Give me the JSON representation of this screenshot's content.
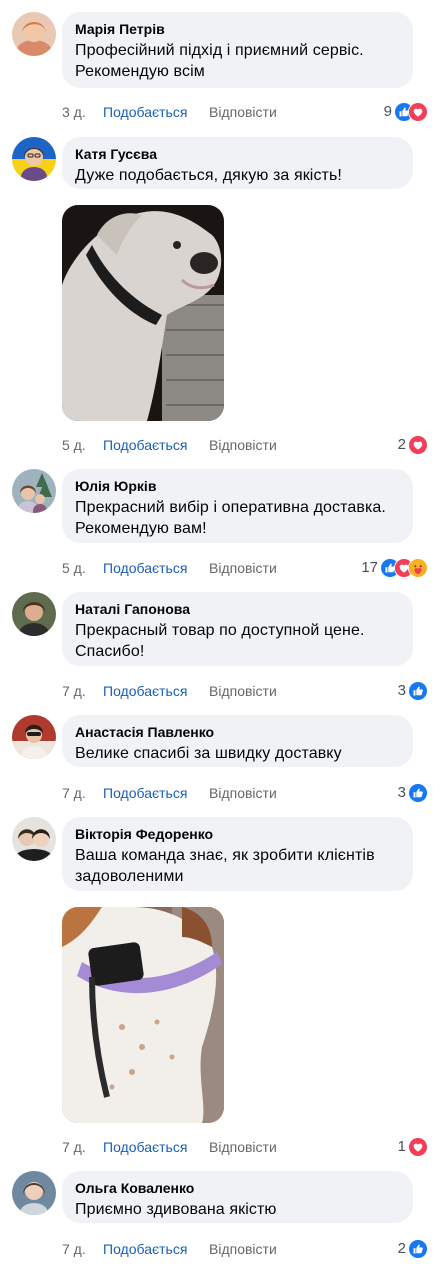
{
  "actions": {
    "like": "Подобається",
    "reply": "Відповісти"
  },
  "comments": [
    {
      "author": "Марія Петрів",
      "text": "Професійний підхід і приємний сервіс. Рекомендую всім",
      "time": "3 д.",
      "reactions_count": "9",
      "reactions": [
        "like-icon",
        "love-icon"
      ]
    },
    {
      "author": "Катя Гусєва",
      "text": "Дуже подобається, дякую за якість!",
      "time": "5 д.",
      "reactions_count": "2",
      "reactions": [
        "love-icon"
      ],
      "has_photo": true
    },
    {
      "author": "Юлія Юрків",
      "text": "Прекрасний вибір і оперативна доставка. Рекомендую вам!",
      "time": "5 д.",
      "reactions_count": "17",
      "reactions": [
        "like-icon",
        "love-icon",
        "care-icon"
      ]
    },
    {
      "author": "Наталі Гапонова",
      "text": "Прекрасный товар по доступной цене. Спасибо!",
      "time": "7 д.",
      "reactions_count": "3",
      "reactions": [
        "like-icon"
      ]
    },
    {
      "author": "Анастасія Павленко",
      "text": "Велике спасибі за швидку доставку",
      "time": "7 д.",
      "reactions_count": "3",
      "reactions": [
        "like-icon"
      ]
    },
    {
      "author": "Вікторія Федоренко",
      "text": "Ваша команда знає, як зробити клієнтів задоволеними",
      "time": "7 д.",
      "reactions_count": "1",
      "reactions": [
        "love-icon"
      ],
      "has_photo": true
    },
    {
      "author": "Ольга Коваленко",
      "text": "Приємно здивована якістю",
      "time": "7 д.",
      "reactions_count": "2",
      "reactions": [
        "like-icon"
      ]
    }
  ],
  "colors": {
    "bubble": "#f0f2f5",
    "like_link": "#1a5fb4",
    "meta": "#65676b",
    "like_reaction": "#1877f2",
    "love_reaction": "#f33e58"
  }
}
